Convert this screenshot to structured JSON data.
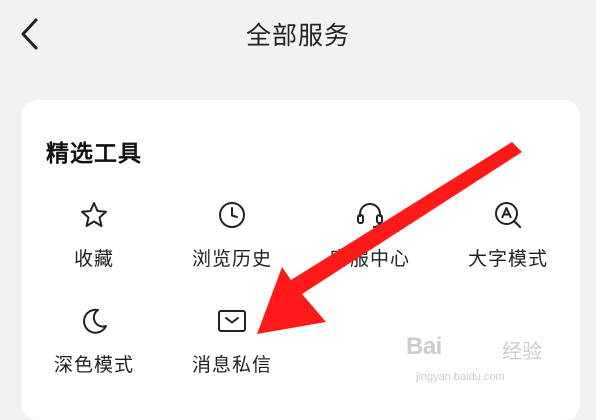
{
  "header": {
    "back_icon": "chevron-left-icon",
    "title": "全部服务"
  },
  "section": {
    "title": "精选工具",
    "tools": [
      {
        "label": "收藏",
        "icon": "star-icon"
      },
      {
        "label": "浏览历史",
        "icon": "clock-icon"
      },
      {
        "label": "客服中心",
        "icon": "headset-icon"
      },
      {
        "label": "大字模式",
        "icon": "large-text-icon"
      },
      {
        "label": "深色模式",
        "icon": "moon-icon"
      },
      {
        "label": "消息私信",
        "icon": "message-icon"
      }
    ]
  },
  "overlay": {
    "arrow_color": "#ff1a1a"
  },
  "watermark": {
    "logo": "Bai",
    "suffix": "经验",
    "url": "jingyan.baidu.com"
  },
  "colors": {
    "background": "#f2f2f2",
    "card": "#ffffff",
    "text": "#222222"
  }
}
